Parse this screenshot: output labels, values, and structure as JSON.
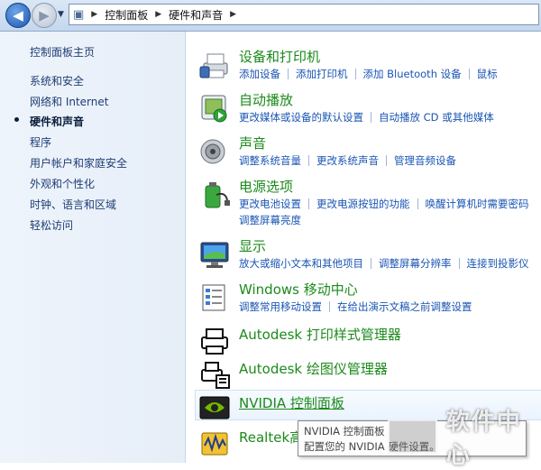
{
  "address": {
    "crumbs": [
      "控制面板",
      "硬件和声音"
    ]
  },
  "left_pane": {
    "home": "控制面板主页",
    "items": [
      {
        "label": "系统和安全"
      },
      {
        "label": "网络和 Internet"
      },
      {
        "label": "硬件和声音",
        "active": true
      },
      {
        "label": "程序"
      },
      {
        "label": "用户帐户和家庭安全"
      },
      {
        "label": "外观和个性化"
      },
      {
        "label": "时钟、语言和区域"
      },
      {
        "label": "轻松访问"
      }
    ]
  },
  "items": [
    {
      "title": "设备和打印机",
      "icon": "printer-icon",
      "links": [
        [
          "添加设备",
          "添加打印机",
          "添加 Bluetooth 设备",
          "鼠标"
        ]
      ]
    },
    {
      "title": "自动播放",
      "icon": "autoplay-icon",
      "links": [
        [
          "更改媒体或设备的默认设置",
          "自动播放 CD 或其他媒体"
        ]
      ]
    },
    {
      "title": "声音",
      "icon": "speaker-icon",
      "links": [
        [
          "调整系统音量",
          "更改系统声音",
          "管理音频设备"
        ]
      ]
    },
    {
      "title": "电源选项",
      "icon": "battery-icon",
      "links": [
        [
          "更改电池设置",
          "更改电源按钮的功能",
          "唤醒计算机时需要密码"
        ],
        [
          "调整屏幕亮度"
        ]
      ]
    },
    {
      "title": "显示",
      "icon": "monitor-icon",
      "links": [
        [
          "放大或缩小文本和其他项目",
          "调整屏幕分辨率",
          "连接到投影仪"
        ]
      ]
    },
    {
      "title": "Windows 移动中心",
      "icon": "mobility-center-icon",
      "links": [
        [
          "调整常用移动设置",
          "在给出演示文稿之前调整设置"
        ]
      ]
    },
    {
      "title": "Autodesk 打印样式管理器",
      "icon": "autodesk-print-style-icon",
      "links": []
    },
    {
      "title": "Autodesk 绘图仪管理器",
      "icon": "autodesk-plotter-icon",
      "links": []
    },
    {
      "title": "NVIDIA 控制面板",
      "icon": "nvidia-icon",
      "links": []
    },
    {
      "title": "Realtek高",
      "icon": "realtek-audio-icon",
      "links": []
    }
  ],
  "tooltip": {
    "line1": "NVIDIA 控制面板",
    "line2": "配置您的 NVIDIA 硬件设置。"
  },
  "watermark": {
    "text": "软件中心"
  }
}
